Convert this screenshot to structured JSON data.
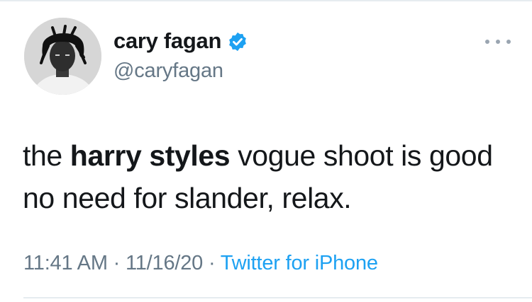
{
  "user": {
    "display_name": "cary fagan",
    "handle": "@caryfagan",
    "verified": true
  },
  "tweet": {
    "text_before": "the ",
    "text_bold": "harry styles",
    "text_after": " vogue shoot is good no need for slander, relax.",
    "time": "11:41 AM",
    "separator": " · ",
    "date": "11/16/20",
    "source": "Twitter for iPhone"
  },
  "colors": {
    "verified_blue": "#1da1f2",
    "link_blue": "#1da1f2",
    "meta_gray": "#657786"
  },
  "icons": {
    "verified": "verified-badge-icon",
    "more": "more-options-icon"
  }
}
